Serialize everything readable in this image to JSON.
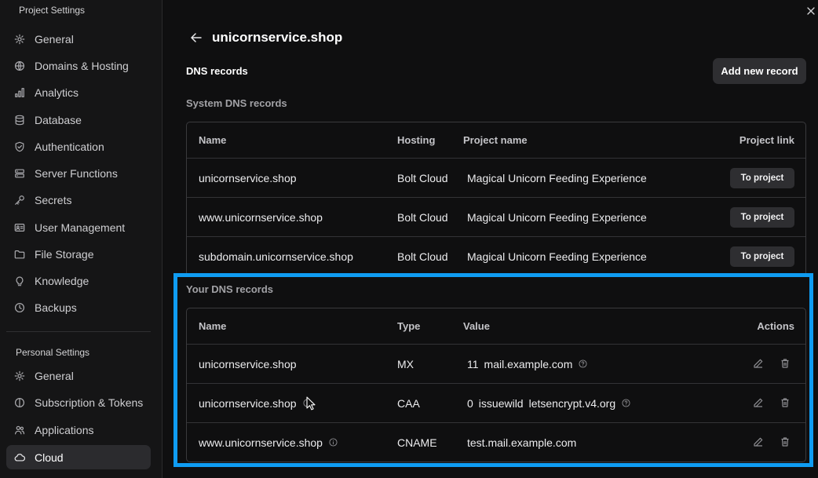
{
  "sidebar": {
    "project_section_title": "Project Settings",
    "project_items": [
      {
        "label": "General",
        "icon": "gear-icon"
      },
      {
        "label": "Domains & Hosting",
        "icon": "globe-icon"
      },
      {
        "label": "Analytics",
        "icon": "bar-chart-icon"
      },
      {
        "label": "Database",
        "icon": "database-icon"
      },
      {
        "label": "Authentication",
        "icon": "shield-check-icon"
      },
      {
        "label": "Server Functions",
        "icon": "server-icon"
      },
      {
        "label": "Secrets",
        "icon": "key-icon"
      },
      {
        "label": "User Management",
        "icon": "id-card-icon"
      },
      {
        "label": "File Storage",
        "icon": "folder-icon"
      },
      {
        "label": "Knowledge",
        "icon": "lightbulb-icon"
      },
      {
        "label": "Backups",
        "icon": "clock-icon"
      }
    ],
    "personal_section_title": "Personal Settings",
    "personal_items": [
      {
        "label": "General",
        "icon": "gear-icon"
      },
      {
        "label": "Subscription & Tokens",
        "icon": "coin-icon"
      },
      {
        "label": "Applications",
        "icon": "people-icon"
      },
      {
        "label": "Cloud",
        "icon": "cloud-icon",
        "active": true
      }
    ]
  },
  "header": {
    "title": "unicornservice.shop",
    "section": "DNS records",
    "add_button": "Add new record"
  },
  "system_dns": {
    "heading": "System DNS records",
    "columns": [
      "Name",
      "Hosting",
      "Project name",
      "Project link"
    ],
    "rows": [
      {
        "name": "unicornservice.shop",
        "hosting": "Bolt Cloud",
        "project": "Magical Unicorn Feeding Experience",
        "link": "To project"
      },
      {
        "name": "www.unicornservice.shop",
        "hosting": "Bolt Cloud",
        "project": "Magical Unicorn Feeding Experience",
        "link": "To project"
      },
      {
        "name": "subdomain.unicornservice.shop",
        "hosting": "Bolt Cloud",
        "project": "Magical Unicorn Feeding Experience",
        "link": "To project"
      }
    ]
  },
  "your_dns": {
    "heading": "Your DNS records",
    "columns": [
      "Name",
      "Type",
      "Value",
      "Actions"
    ],
    "rows": [
      {
        "name": "unicornservice.shop",
        "type": "MX",
        "priority": "11",
        "value": "mail.example.com"
      },
      {
        "name": "unicornservice.shop",
        "type": "CAA",
        "priority": "0",
        "tag": "issuewild",
        "value": "letsencrypt.v4.org"
      },
      {
        "name": "www.unicornservice.shop",
        "type": "CNAME",
        "value": "test.mail.example.com"
      }
    ]
  },
  "colors": {
    "accent_highlight": "#0f9cf2",
    "background": "#0f0f10",
    "sidebar": "#151516"
  }
}
